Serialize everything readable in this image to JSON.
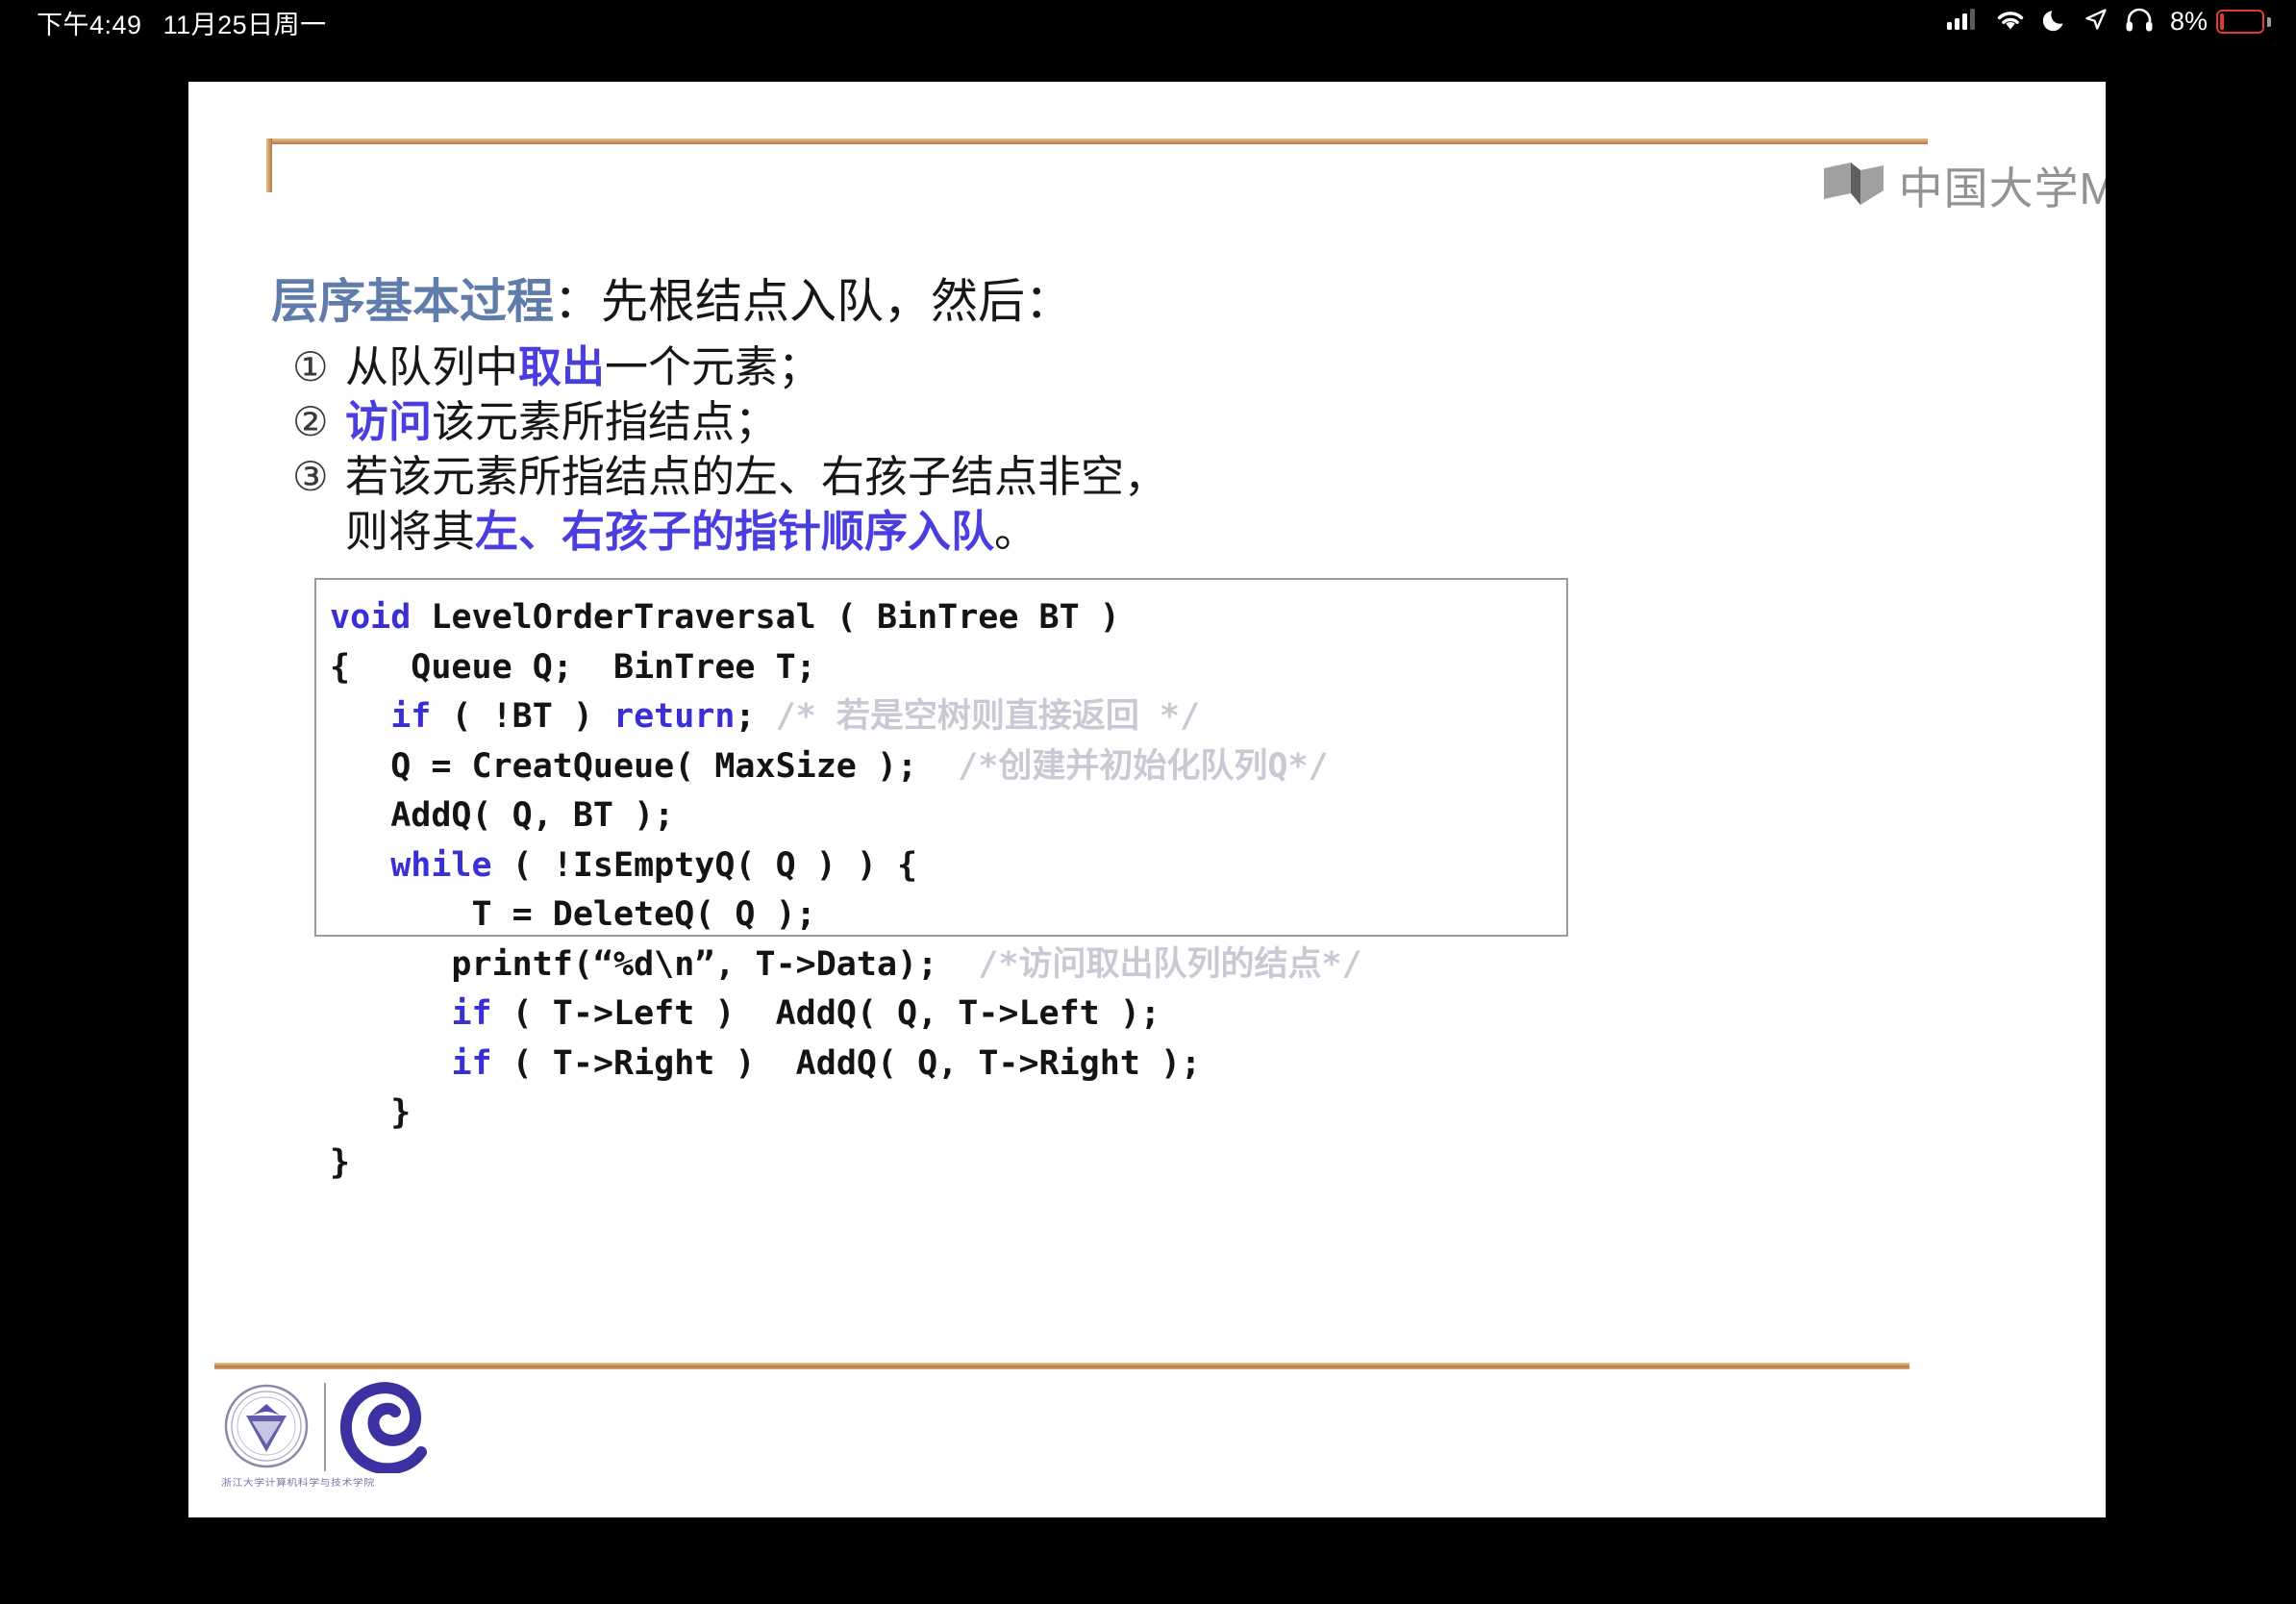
{
  "status_bar": {
    "time": "下午4:49",
    "date": "11月25日周一",
    "icons": [
      "cellular-signal-icon",
      "wifi-icon",
      "moon-do-not-disturb-icon",
      "location-arrow-icon",
      "headphones-icon"
    ],
    "battery_percent": "8%",
    "battery_color": "#e03b2e"
  },
  "slide": {
    "watermark": {
      "icon": "book-logo-icon",
      "text": "中国大学M"
    },
    "title": {
      "accent": "层序基本过程",
      "rest": "：先根结点入队，然后："
    },
    "steps": [
      {
        "num": "①",
        "segments": [
          {
            "text": "从队列中",
            "highlight": false
          },
          {
            "text": "取出",
            "highlight": true
          },
          {
            "text": "一个元素；",
            "highlight": false
          }
        ]
      },
      {
        "num": "②",
        "segments": [
          {
            "text": "访问",
            "highlight": true
          },
          {
            "text": "该元素所指结点；",
            "highlight": false
          }
        ]
      },
      {
        "num": "③",
        "segments": [
          {
            "text": "若该元素所指结点的左、右孩子结点非空，",
            "highlight": false
          }
        ],
        "continuation": [
          {
            "text": "则将其",
            "highlight": false
          },
          {
            "text": "左、右孩子的指针顺序入队",
            "highlight": true
          },
          {
            "text": "。",
            "highlight": false
          }
        ]
      }
    ],
    "code": {
      "lines": [
        [
          {
            "text": "void",
            "type": "keyword"
          },
          {
            "text": " LevelOrderTraversal ( BinTree BT )",
            "type": "plain"
          }
        ],
        [
          {
            "text": "{   Queue Q;  BinTree T;",
            "type": "plain"
          }
        ],
        [
          {
            "text": "   ",
            "type": "plain"
          },
          {
            "text": "if",
            "type": "keyword"
          },
          {
            "text": " ( !BT ) ",
            "type": "plain"
          },
          {
            "text": "return",
            "type": "keyword"
          },
          {
            "text": "; ",
            "type": "plain"
          },
          {
            "text": "/* 若是空树则直接返回 */",
            "type": "comment"
          }
        ],
        [
          {
            "text": "   Q = CreatQueue( MaxSize );  ",
            "type": "plain"
          },
          {
            "text": "/*创建并初始化队列Q*/",
            "type": "comment"
          }
        ],
        [
          {
            "text": "   AddQ( Q, BT );",
            "type": "plain"
          }
        ],
        [
          {
            "text": "   ",
            "type": "plain"
          },
          {
            "text": "while",
            "type": "keyword"
          },
          {
            "text": " ( !IsEmptyQ( Q ) ) {",
            "type": "plain"
          }
        ],
        [
          {
            "text": "       T = DeleteQ( Q );",
            "type": "plain"
          }
        ],
        [
          {
            "text": "      printf(“%d\\n”, T->Data);  ",
            "type": "plain"
          },
          {
            "text": "/*访问取出队列的结点*/",
            "type": "comment"
          }
        ],
        [
          {
            "text": "      ",
            "type": "plain"
          },
          {
            "text": "if",
            "type": "keyword"
          },
          {
            "text": " ( T->Left )  AddQ( Q, T->Left );",
            "type": "plain"
          }
        ],
        [
          {
            "text": "      ",
            "type": "plain"
          },
          {
            "text": "if",
            "type": "keyword"
          },
          {
            "text": " ( T->Right )  AddQ( Q, T->Right );",
            "type": "plain"
          }
        ],
        [
          {
            "text": "   }",
            "type": "plain"
          }
        ],
        [
          {
            "text": "}",
            "type": "plain"
          }
        ]
      ]
    },
    "footer": {
      "seal_logo": "university-seal-icon",
      "e_logo": "spiral-e-logo-icon",
      "caption": "浙江大学计算机科学与技术学院"
    },
    "colors": {
      "title_accent": "#5f7caa",
      "highlight": "#4b3ede",
      "code_keyword": "#3a2fd6",
      "code_comment": "#c9c9d4",
      "rule": "#b5793f"
    }
  }
}
